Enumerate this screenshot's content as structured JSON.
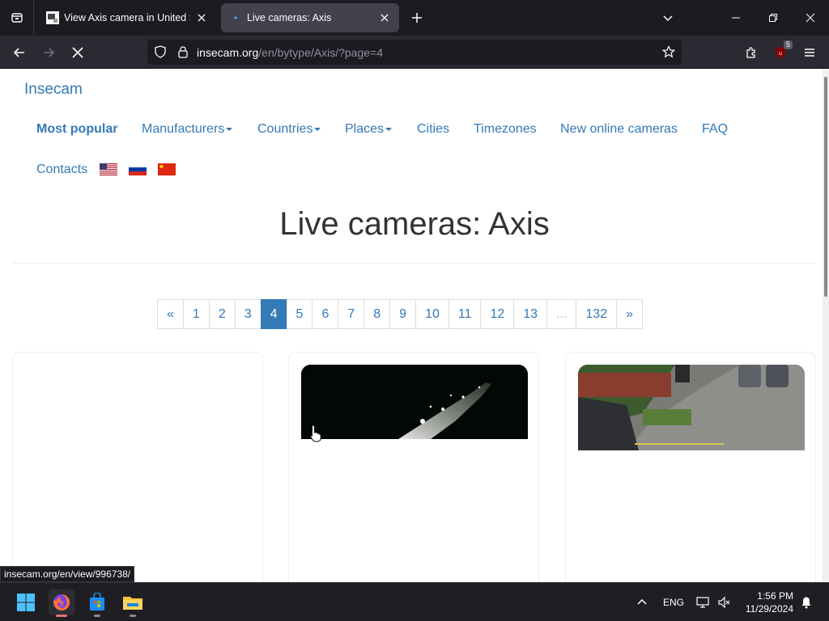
{
  "browser": {
    "tabs": [
      {
        "title": "View Axis camera in United Stat",
        "active": false
      },
      {
        "title": "Live cameras: Axis",
        "active": true
      }
    ],
    "url": {
      "domain": "insecam.org",
      "path": "/en/bytype/Axis/?page=4"
    },
    "extension_badge": "5",
    "status_url": "insecam.org/en/view/996738/"
  },
  "site": {
    "brand": "Insecam",
    "nav": {
      "most_popular": "Most popular",
      "manufacturers": "Manufacturers",
      "countries": "Countries",
      "places": "Places",
      "cities": "Cities",
      "timezones": "Timezones",
      "new_online": "New online cameras",
      "faq": "FAQ",
      "contacts": "Contacts"
    },
    "heading": "Live cameras: Axis",
    "pagination": [
      "«",
      "1",
      "2",
      "3",
      "4",
      "5",
      "6",
      "7",
      "8",
      "9",
      "10",
      "11",
      "12",
      "13",
      "...",
      "132",
      "»"
    ],
    "current_page": "4"
  },
  "taskbar": {
    "language": "ENG",
    "time": "1:56 PM",
    "date": "11/29/2024"
  },
  "colors": {
    "link": "#337ab7",
    "active_page": "#337ab7",
    "tab_active": "#42414d",
    "chrome_bg": "#1c1b22"
  }
}
